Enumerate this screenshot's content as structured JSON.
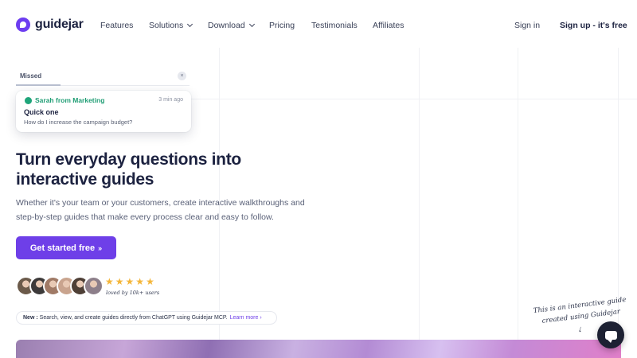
{
  "header": {
    "logo_text": "guidejar",
    "nav": [
      "Features",
      "Solutions",
      "Download",
      "Pricing",
      "Testimonials",
      "Affiliates"
    ],
    "sign_in": "Sign in",
    "sign_up": "Sign up - it's free"
  },
  "widget": {
    "tab_label": "Missed",
    "close_glyph": "×",
    "sender": "Sarah from Marketing",
    "time": "3 min ago",
    "title": "Quick one",
    "message": "How do I increase the campaign budget?"
  },
  "hero": {
    "headline": "Turn everyday questions into interactive guides",
    "subtext": "Whether it's your team or your customers, create interactive walkthroughs and step-by-step guides that make every process clear and easy to follow.",
    "cta_label": "Get started free",
    "cta_arrow": "»"
  },
  "social_proof": {
    "rating": 5,
    "loved_text": "loved by 10k+ users",
    "avatar_colors": [
      "#6b5a4a",
      "#3d3a3a",
      "#a07a66",
      "#c9a48e",
      "#4e3f36",
      "#8d7f8a"
    ]
  },
  "announcement": {
    "label": "New :",
    "text": "Search, view, and create guides directly from ChatGPT using Guidejar MCP.",
    "link": "Learn more",
    "link_arrow": "›"
  },
  "annotation": {
    "text": "This is an interactive guide created using Guidejar",
    "arrow": "↓"
  },
  "colors": {
    "brand": "#6e3fe8",
    "success": "#1f9d74",
    "star": "#f4b63a"
  }
}
